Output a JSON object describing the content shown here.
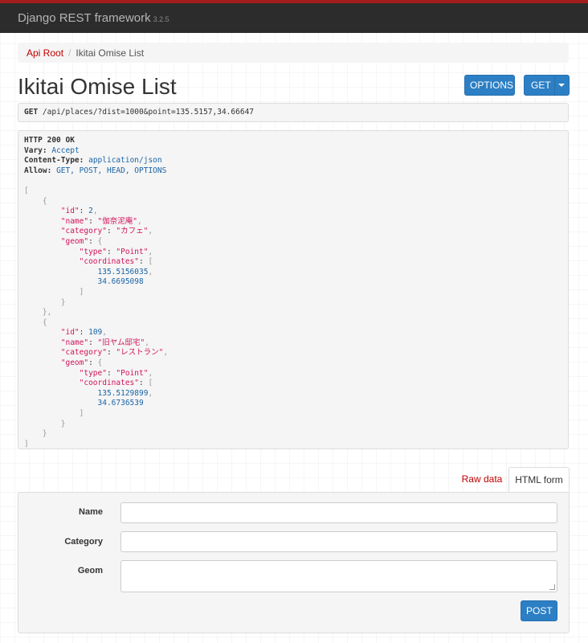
{
  "navbar": {
    "brand": "Django REST framework",
    "version": "3.2.5",
    "bg_color": "#2c2c2c",
    "accent_color": "#a51c1c"
  },
  "breadcrumb": {
    "root_label": "Api Root",
    "separator": "/",
    "current_label": "Ikitai Omise List"
  },
  "page": {
    "title": "Ikitai Omise List"
  },
  "buttons": {
    "options_label": "OPTIONS",
    "get_label": "GET",
    "post_label": "POST",
    "primary_color": "#2c7fc4"
  },
  "request": {
    "method": "GET",
    "url": "/api/places/?dist=1000&point=135.5157,34.66647"
  },
  "response": {
    "status": "HTTP 200 OK",
    "headers": [
      {
        "name": "Vary:",
        "value": "Accept"
      },
      {
        "name": "Content-Type:",
        "value": "application/json"
      },
      {
        "name": "Allow:",
        "value": "GET, POST, HEAD, OPTIONS"
      }
    ],
    "body": [
      {
        "id": "2",
        "name": "\"伽奈泥庵\"",
        "category": "\"カフェ\"",
        "geom_type": "\"Point\"",
        "coordinates": [
          "135.5156035",
          "34.6695098"
        ]
      },
      {
        "id": "109",
        "name": "\"旧ヤム邸宅\"",
        "category": "\"レストラン\"",
        "geom_type": "\"Point\"",
        "coordinates": [
          "135.5129899",
          "34.6736539"
        ]
      }
    ],
    "keys": {
      "id": "\"id\"",
      "name": "\"name\"",
      "category": "\"category\"",
      "geom": "\"geom\"",
      "type": "\"type\"",
      "coordinates": "\"coordinates\""
    }
  },
  "tabs": {
    "raw": "Raw data",
    "html": "HTML form"
  },
  "form": {
    "name_label": "Name",
    "category_label": "Category",
    "geom_label": "Geom",
    "name_value": "",
    "category_value": "",
    "geom_value": ""
  }
}
